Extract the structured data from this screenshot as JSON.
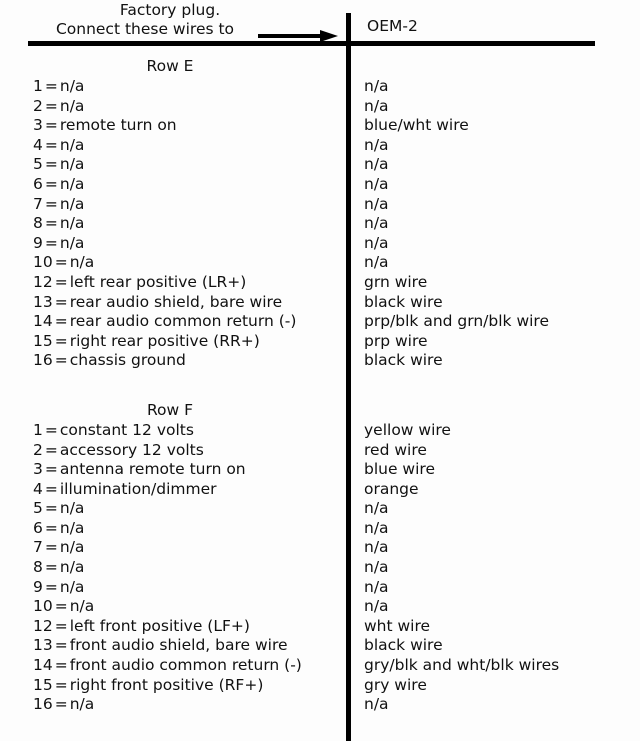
{
  "header": {
    "line1": "Factory plug.",
    "line2": "Connect these wires to",
    "arrow_icon": "right-arrow-icon",
    "target_label": "OEM-2"
  },
  "separator_color": "#000000",
  "sections": [
    {
      "title": "Row E",
      "rows": [
        {
          "pin": "1",
          "sep": "=",
          "function": "n/a",
          "wire": "n/a"
        },
        {
          "pin": "2",
          "sep": "=",
          "function": "n/a",
          "wire": "n/a"
        },
        {
          "pin": "3",
          "sep": "=",
          "function": "remote turn on",
          "wire": "blue/wht wire"
        },
        {
          "pin": "4",
          "sep": "=",
          "function": "n/a",
          "wire": "n/a"
        },
        {
          "pin": "5",
          "sep": "=",
          "function": "n/a",
          "wire": "n/a"
        },
        {
          "pin": "6",
          "sep": "=",
          "function": "n/a",
          "wire": "n/a"
        },
        {
          "pin": "7",
          "sep": "=",
          "function": "n/a",
          "wire": "n/a"
        },
        {
          "pin": "8",
          "sep": "=",
          "function": "n/a",
          "wire": "n/a"
        },
        {
          "pin": "9",
          "sep": "=",
          "function": "n/a",
          "wire": "n/a"
        },
        {
          "pin": "10",
          "sep": "=",
          "function": "n/a",
          "wire": "n/a"
        },
        {
          "pin": "12",
          "sep": "=",
          "function": "left rear positive (LR+)",
          "wire": "grn wire"
        },
        {
          "pin": "13",
          "sep": "=",
          "function": "rear audio shield, bare wire",
          "wire": "black wire"
        },
        {
          "pin": "14",
          "sep": "=",
          "function": "rear audio common return (-)",
          "wire": "prp/blk and grn/blk wire"
        },
        {
          "pin": "15",
          "sep": "=",
          "function": "right rear positive (RR+)",
          "wire": "prp wire"
        },
        {
          "pin": "16",
          "sep": "=",
          "function": "chassis ground",
          "wire": "black wire"
        }
      ]
    },
    {
      "title": "Row F",
      "rows": [
        {
          "pin": "1",
          "sep": "=",
          "function": "constant 12 volts",
          "wire": "yellow wire"
        },
        {
          "pin": "2",
          "sep": "=",
          "function": "accessory 12 volts",
          "wire": "red wire"
        },
        {
          "pin": "3",
          "sep": "=",
          "function": "antenna remote turn on",
          "wire": "blue wire"
        },
        {
          "pin": "4",
          "sep": "=",
          "function": "illumination/dimmer",
          "wire": "orange"
        },
        {
          "pin": "5",
          "sep": "=",
          "function": "n/a",
          "wire": "n/a"
        },
        {
          "pin": "6",
          "sep": "=",
          "function": "n/a",
          "wire": "n/a"
        },
        {
          "pin": "7",
          "sep": "=",
          "function": "n/a",
          "wire": "n/a"
        },
        {
          "pin": "8",
          "sep": "=",
          "function": "n/a",
          "wire": "n/a"
        },
        {
          "pin": "9",
          "sep": "=",
          "function": "n/a",
          "wire": "n/a"
        },
        {
          "pin": "10",
          "sep": "=",
          "function": "n/a",
          "wire": "n/a"
        },
        {
          "pin": "12",
          "sep": "=",
          "function": "left front positive (LF+)",
          "wire": "wht wire"
        },
        {
          "pin": "13",
          "sep": "=",
          "function": "front audio shield, bare wire",
          "wire": "black wire"
        },
        {
          "pin": "14",
          "sep": "=",
          "function": "front audio common return (-)",
          "wire": "gry/blk and wht/blk wires"
        },
        {
          "pin": "15",
          "sep": "=",
          "function": "right front positive (RF+)",
          "wire": "gry wire"
        },
        {
          "pin": "16",
          "sep": "=",
          "function": "n/a",
          "wire": "n/a"
        }
      ]
    }
  ]
}
